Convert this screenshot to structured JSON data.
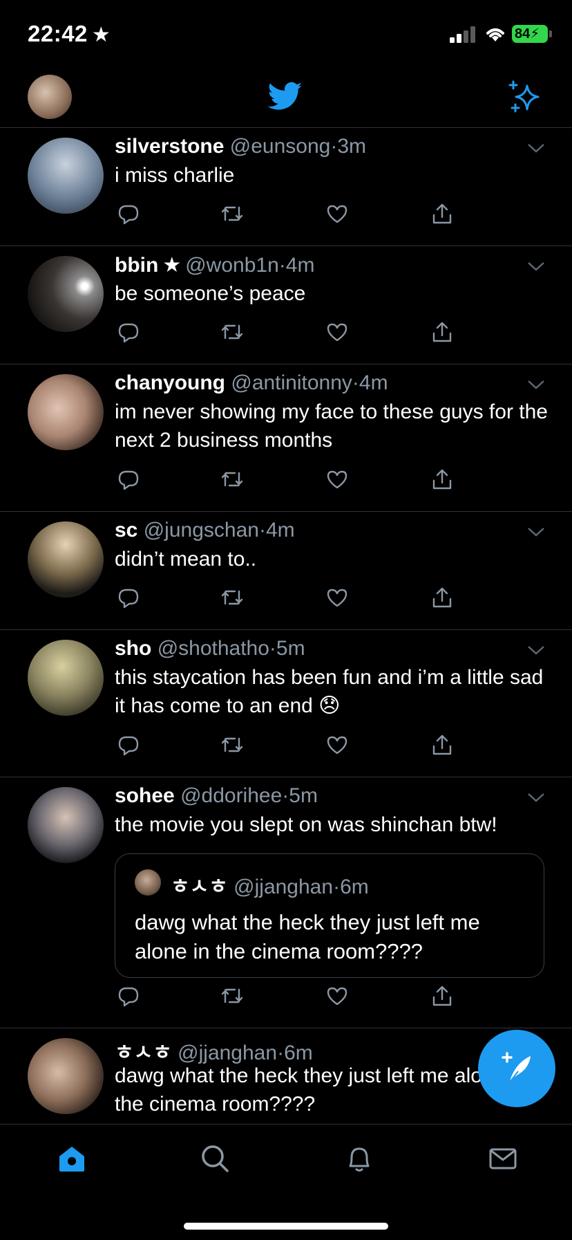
{
  "status_bar": {
    "time": "22:42",
    "star": "★",
    "battery": "84"
  },
  "colors": {
    "accent": "#1d9bf0",
    "background": "#000000",
    "secondary_text": "#8b98a5",
    "divider": "#2f3336",
    "battery": "#32d74b"
  },
  "header": {
    "logo_icon": "twitter-bird-icon",
    "sparkle_icon": "sparkle-icon"
  },
  "tweets": [
    {
      "name": "silverstone",
      "verified": "",
      "handle": "@eunsong",
      "time": "3m",
      "text": "i miss charlie"
    },
    {
      "name": "bbin",
      "verified": "★",
      "handle": "@wonb1n",
      "time": "4m",
      "text": "be someone’s peace"
    },
    {
      "name": "chanyoung",
      "verified": "",
      "handle": "@antinitonny",
      "time": "4m",
      "text": "im never showing my face to these guys for the next 2 business months"
    },
    {
      "name": "sc",
      "verified": "",
      "handle": "@jungschan",
      "time": "4m",
      "text": "didn’t mean to.."
    },
    {
      "name": "sho",
      "verified": "",
      "handle": "@shothatho",
      "time": "5m",
      "text": "this staycation has been fun and i’m a little sad it has come to an end 😞"
    },
    {
      "name": "sohee",
      "verified": "",
      "handle": "@ddorihee",
      "time": "5m",
      "text": "the movie you slept on was shinchan btw!",
      "quote": {
        "name": "ㅎㅅㅎ",
        "handle": "@jjanghan",
        "time": "6m",
        "text": "dawg what the heck they just left me alone in the cinema room????"
      }
    },
    {
      "name": "ㅎㅅㅎ",
      "verified": "",
      "handle": "@jjanghan",
      "time": "6m",
      "text": "dawg what the heck they just left me alone in the cinema room????"
    }
  ],
  "separator": "·",
  "tab_bar": {
    "items": [
      "home-icon",
      "search-icon",
      "notifications-bell-icon",
      "messages-mail-icon"
    ],
    "active": "home-icon"
  }
}
